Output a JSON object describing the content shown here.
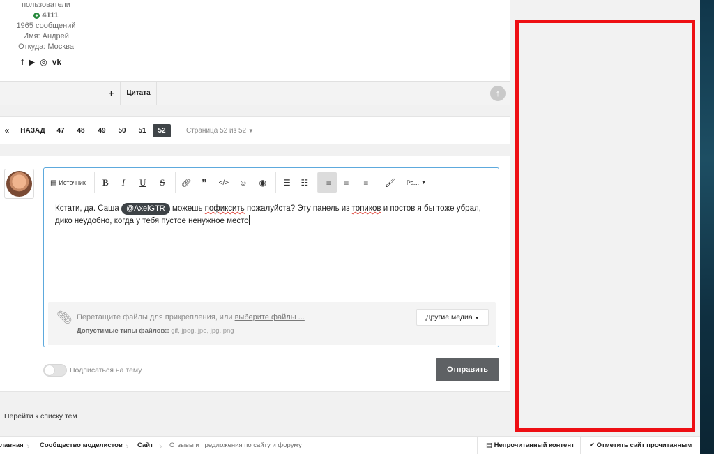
{
  "author": {
    "group": "пользователи",
    "reputation": "4111",
    "posts": "1965 сообщений",
    "name": "Имя: Андрей",
    "location": "Откуда: Москва",
    "social_icons": [
      "facebook-icon",
      "youtube-icon",
      "instagram-icon",
      "vk-icon"
    ]
  },
  "post_actions": {
    "multiquote": "+",
    "quote": "Цитата"
  },
  "pagination": {
    "prev": "«",
    "back": "НАЗАД",
    "pages": [
      "47",
      "48",
      "49",
      "50",
      "51",
      "52"
    ],
    "current": "52",
    "page_of": "Страница 52 из 52"
  },
  "editor": {
    "source": "Источник",
    "format_size": "Ра...",
    "text_before": "Кстати, да. Саша ",
    "mention": "@AxelGTR",
    "text_mid1": " можешь ",
    "misspelled1": "пофиксить",
    "text_mid2": " пожалуйста? Эту панель из ",
    "misspelled2": "топиков",
    "text_mid3": " и постов я бы тоже убрал,",
    "text_line2": "дико неудобно, когда у тебя пустое ненужное место"
  },
  "attachments": {
    "drop_text": "Перетащите файлы для прикрепления, или ",
    "choose_link": "выберите файлы ...",
    "allowed_label": "Допустимые типы файлов::",
    "allowed_types": " gif, jpeg, jpe, jpg, png",
    "other_media": "Другие медиа"
  },
  "reply": {
    "subscribe_label": "Подписаться на тему",
    "send": "Отправить"
  },
  "back_to_list": "Перейти к списку тем",
  "breadcrumb": {
    "items": [
      "лавная",
      "Сообщество моделистов",
      "Сайт",
      "Отзывы и предложения по сайту и форуму"
    ],
    "unread": "Непрочитанный контент",
    "mark_read": "Отметить сайт прочитанным"
  },
  "colors": {
    "highlight_box": "#ee0f14",
    "reputation": "#27893c",
    "editor_border": "#5da9dd"
  }
}
